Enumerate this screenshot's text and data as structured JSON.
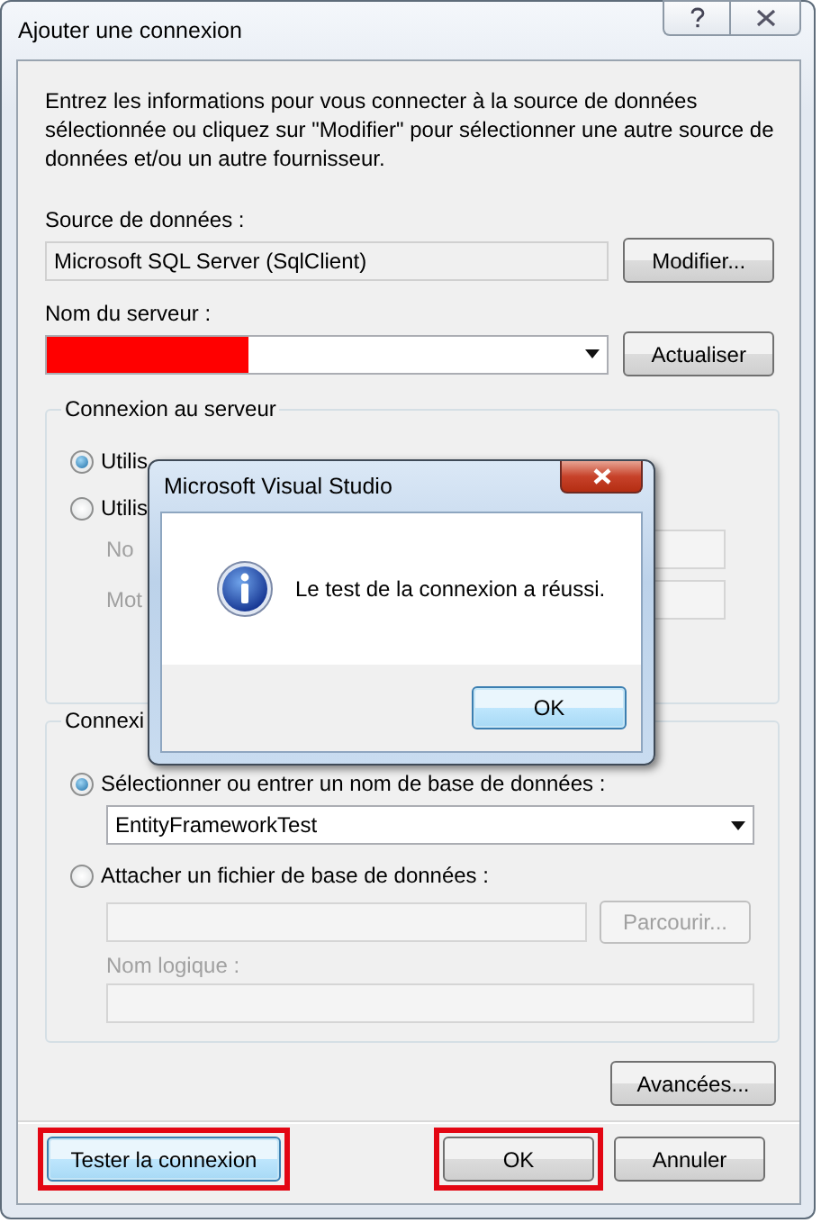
{
  "window": {
    "title": "Ajouter une connexion"
  },
  "intro": "Entrez les informations pour vous connecter à la source de données sélectionnée ou cliquez sur \"Modifier\" pour sélectionner une autre source de données et/ou un autre fournisseur.",
  "data_source": {
    "label": "Source de données :",
    "value": "Microsoft SQL Server (SqlClient)",
    "button": "Modifier..."
  },
  "server_name": {
    "label": "Nom du serveur :",
    "redacted": true,
    "button": "Actualiser"
  },
  "server_group": {
    "legend": "Connexion au serveur",
    "options": [
      {
        "label": "Utilis",
        "selected": true
      },
      {
        "label": "Utilis",
        "selected": false
      }
    ],
    "fields": [
      {
        "label": "No",
        "disabled": true
      },
      {
        "label": "Mot",
        "disabled": true
      }
    ]
  },
  "database_group": {
    "legend": "Connexi",
    "options": [
      {
        "label": "Sélectionner ou entrer un nom de base de données :",
        "selected": true
      },
      {
        "label": "Attacher un fichier de base de données :",
        "selected": false
      }
    ],
    "database": "EntityFrameworkTest",
    "browse_button": {
      "label": "Parcourir...",
      "disabled": true
    },
    "logical_name": {
      "label": "Nom logique :",
      "disabled": true
    }
  },
  "advanced_button": "Avancées...",
  "footer_buttons": [
    {
      "label": "Tester la connexion",
      "kind": "default",
      "highlighted": true
    },
    {
      "label": "OK",
      "kind": "normal",
      "highlighted": true
    },
    {
      "label": "Annuler",
      "kind": "normal",
      "highlighted": false
    }
  ],
  "message_box": {
    "title": "Microsoft Visual Studio",
    "message": "Le test de la connexion a réussi.",
    "button": "OK"
  }
}
